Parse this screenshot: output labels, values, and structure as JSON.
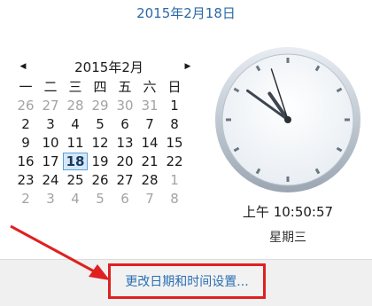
{
  "header": {
    "full_date": "2015年2月18日"
  },
  "calendar": {
    "month_title": "2015年2月",
    "prev_icon": "◀",
    "next_icon": "▶",
    "weekdays": [
      "一",
      "二",
      "三",
      "四",
      "五",
      "六",
      "日"
    ],
    "weeks": [
      [
        "26",
        "27",
        "28",
        "29",
        "30",
        "31",
        "1"
      ],
      [
        "2",
        "3",
        "4",
        "5",
        "6",
        "7",
        "8"
      ],
      [
        "9",
        "10",
        "11",
        "12",
        "13",
        "14",
        "15"
      ],
      [
        "16",
        "17",
        "18",
        "19",
        "20",
        "21",
        "22"
      ],
      [
        "23",
        "24",
        "25",
        "26",
        "27",
        "28",
        "1"
      ],
      [
        "2",
        "3",
        "4",
        "5",
        "6",
        "7",
        "8"
      ]
    ],
    "muted": [
      [
        true,
        true,
        true,
        true,
        true,
        true,
        false
      ],
      [
        false,
        false,
        false,
        false,
        false,
        false,
        false
      ],
      [
        false,
        false,
        false,
        false,
        false,
        false,
        false
      ],
      [
        false,
        false,
        false,
        false,
        false,
        false,
        false
      ],
      [
        false,
        false,
        false,
        false,
        false,
        false,
        true
      ],
      [
        true,
        true,
        true,
        true,
        true,
        true,
        true
      ]
    ],
    "today_day": "18"
  },
  "clock": {
    "hours": 10,
    "minutes": 50,
    "seconds": 57
  },
  "time_text": "上午 10:50:57",
  "weekday_text": "星期三",
  "footer": {
    "change_link": "更改日期和时间设置..."
  },
  "colors": {
    "link": "#2a6fb3",
    "highlight": "#e02020",
    "today_border": "#5aa0dc"
  }
}
